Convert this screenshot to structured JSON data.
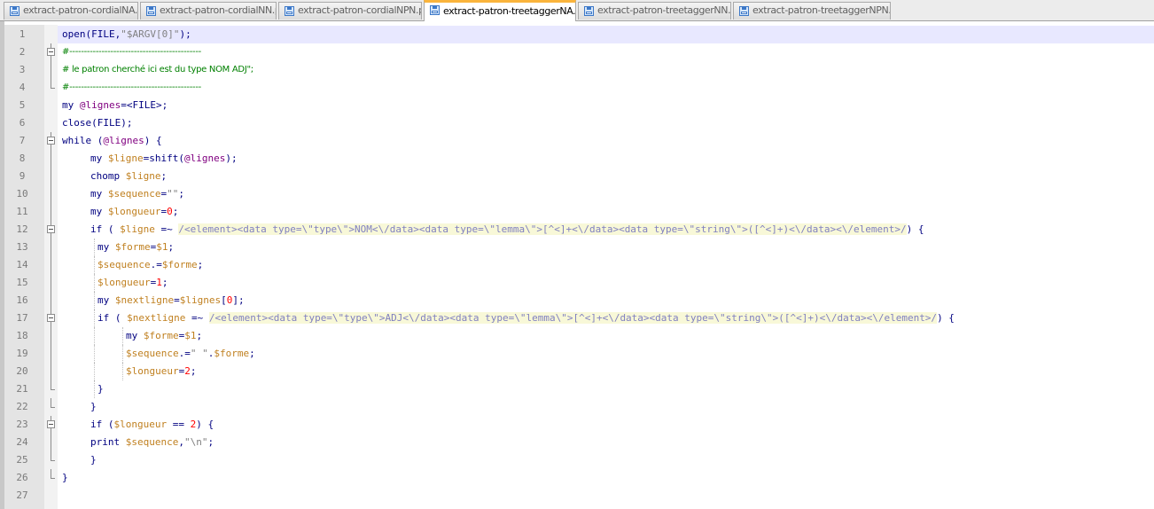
{
  "tabs": [
    {
      "label": "extract-patron-cordialNA.pl",
      "active": false
    },
    {
      "label": "extract-patron-cordialNN.pl",
      "active": false
    },
    {
      "label": "extract-patron-cordialNPN.pl",
      "active": false
    },
    {
      "label": "extract-patron-treetaggerNA.pl",
      "active": true
    },
    {
      "label": "extract-patron-treetaggerNN.pl",
      "active": false
    },
    {
      "label": "extract-patron-treetaggerNPN.pl",
      "active": false
    }
  ],
  "icons": {
    "tab": "floppy-disk-icon",
    "fold": "fold-minus-icon"
  },
  "colors": {
    "keyword": "#000080",
    "array": "#800080",
    "scalar": "#c08020",
    "string": "#808080",
    "number": "#ff0000",
    "comment": "#008000",
    "regex": "#8080c0",
    "active_tab_accent": "#fab43c"
  },
  "editor": {
    "lines": [
      {
        "n": "1",
        "tokens": [
          {
            "t": "open(FILE,",
            "c": "kw"
          },
          {
            "t": "\"$ARGV[0]\"",
            "c": "str"
          },
          {
            "t": ");",
            "c": "kw"
          }
        ]
      },
      {
        "n": "2",
        "cmt": true,
        "tokens": [
          {
            "t": "#---------------------------------------------",
            "c": "cmt"
          }
        ]
      },
      {
        "n": "3",
        "cmt": true,
        "tokens": [
          {
            "t": "# le patron cherché ici est du type NOM ADJ\";",
            "c": "cmt"
          }
        ]
      },
      {
        "n": "4",
        "cmt": true,
        "tokens": [
          {
            "t": "#---------------------------------------------",
            "c": "cmt"
          }
        ]
      },
      {
        "n": "5",
        "tokens": [
          {
            "t": "my ",
            "c": "kw"
          },
          {
            "t": "@lignes",
            "c": "arr"
          },
          {
            "t": "=<FILE>;",
            "c": "kw"
          }
        ]
      },
      {
        "n": "6",
        "tokens": [
          {
            "t": "close(FILE);",
            "c": "kw"
          }
        ]
      },
      {
        "n": "7",
        "tokens": [
          {
            "t": "while (",
            "c": "kw"
          },
          {
            "t": "@lignes",
            "c": "arr"
          },
          {
            "t": ") {",
            "c": "kw"
          }
        ]
      },
      {
        "n": "8",
        "tokens": [
          {
            "t": "my ",
            "c": "kw"
          },
          {
            "t": "$ligne",
            "c": "var"
          },
          {
            "t": "=shift(",
            "c": "kw"
          },
          {
            "t": "@lignes",
            "c": "arr"
          },
          {
            "t": ");",
            "c": "kw"
          }
        ]
      },
      {
        "n": "9",
        "tokens": [
          {
            "t": "chomp ",
            "c": "kw"
          },
          {
            "t": "$ligne",
            "c": "var"
          },
          {
            "t": ";",
            "c": "kw"
          }
        ]
      },
      {
        "n": "10",
        "tokens": [
          {
            "t": "my ",
            "c": "kw"
          },
          {
            "t": "$sequence",
            "c": "var"
          },
          {
            "t": "=",
            "c": "kw"
          },
          {
            "t": "\"\"",
            "c": "str"
          },
          {
            "t": ";",
            "c": "kw"
          }
        ]
      },
      {
        "n": "11",
        "tokens": [
          {
            "t": "my ",
            "c": "kw"
          },
          {
            "t": "$longueur",
            "c": "var"
          },
          {
            "t": "=",
            "c": "kw"
          },
          {
            "t": "0",
            "c": "num"
          },
          {
            "t": ";",
            "c": "kw"
          }
        ]
      },
      {
        "n": "12",
        "tokens": [
          {
            "t": "if ( ",
            "c": "kw"
          },
          {
            "t": "$ligne",
            "c": "var"
          },
          {
            "t": " =~ ",
            "c": "kw"
          },
          {
            "t": "/<element><data type=\\\"type\\\">NOM<\\/data><data type=\\\"lemma\\\">[^<]+<\\/data><data type=\\\"string\\\">([^<]+)<\\/data><\\/element>/",
            "c": "rx"
          },
          {
            "t": ") {",
            "c": "kw"
          }
        ]
      },
      {
        "n": "13",
        "tokens": [
          {
            "t": "my ",
            "c": "kw"
          },
          {
            "t": "$forme",
            "c": "var"
          },
          {
            "t": "=",
            "c": "kw"
          },
          {
            "t": "$1",
            "c": "var"
          },
          {
            "t": ";",
            "c": "kw"
          }
        ]
      },
      {
        "n": "14",
        "tokens": [
          {
            "t": "$sequence",
            "c": "var"
          },
          {
            "t": ".=",
            "c": "kw"
          },
          {
            "t": "$forme",
            "c": "var"
          },
          {
            "t": ";",
            "c": "kw"
          }
        ]
      },
      {
        "n": "15",
        "tokens": [
          {
            "t": "$longueur",
            "c": "var"
          },
          {
            "t": "=",
            "c": "kw"
          },
          {
            "t": "1",
            "c": "num"
          },
          {
            "t": ";",
            "c": "kw"
          }
        ]
      },
      {
        "n": "16",
        "tokens": [
          {
            "t": "my ",
            "c": "kw"
          },
          {
            "t": "$nextligne",
            "c": "var"
          },
          {
            "t": "=",
            "c": "kw"
          },
          {
            "t": "$lignes",
            "c": "var"
          },
          {
            "t": "[",
            "c": "kw"
          },
          {
            "t": "0",
            "c": "num"
          },
          {
            "t": "];",
            "c": "kw"
          }
        ]
      },
      {
        "n": "17",
        "tokens": [
          {
            "t": "if ( ",
            "c": "kw"
          },
          {
            "t": "$nextligne",
            "c": "var"
          },
          {
            "t": " =~ ",
            "c": "kw"
          },
          {
            "t": "/<element><data type=\\\"type\\\">ADJ<\\/data><data type=\\\"lemma\\\">[^<]+<\\/data><data type=\\\"string\\\">([^<]+)<\\/data><\\/element>/",
            "c": "rx"
          },
          {
            "t": ") {",
            "c": "kw"
          }
        ]
      },
      {
        "n": "18",
        "tokens": [
          {
            "t": "my ",
            "c": "kw"
          },
          {
            "t": "$forme",
            "c": "var"
          },
          {
            "t": "=",
            "c": "kw"
          },
          {
            "t": "$1",
            "c": "var"
          },
          {
            "t": ";",
            "c": "kw"
          }
        ]
      },
      {
        "n": "19",
        "tokens": [
          {
            "t": "$sequence",
            "c": "var"
          },
          {
            "t": ".=",
            "c": "kw"
          },
          {
            "t": "\" \"",
            "c": "str"
          },
          {
            "t": ".",
            "c": "kw"
          },
          {
            "t": "$forme",
            "c": "var"
          },
          {
            "t": ";",
            "c": "kw"
          }
        ]
      },
      {
        "n": "20",
        "tokens": [
          {
            "t": "$longueur",
            "c": "var"
          },
          {
            "t": "=",
            "c": "kw"
          },
          {
            "t": "2",
            "c": "num"
          },
          {
            "t": ";",
            "c": "kw"
          }
        ]
      },
      {
        "n": "21",
        "tokens": [
          {
            "t": "}",
            "c": "kw"
          }
        ]
      },
      {
        "n": "22",
        "tokens": [
          {
            "t": "}",
            "c": "kw"
          }
        ]
      },
      {
        "n": "23",
        "tokens": [
          {
            "t": "if (",
            "c": "kw"
          },
          {
            "t": "$longueur",
            "c": "var"
          },
          {
            "t": " == ",
            "c": "kw"
          },
          {
            "t": "2",
            "c": "num"
          },
          {
            "t": ") {",
            "c": "kw"
          }
        ]
      },
      {
        "n": "24",
        "tokens": [
          {
            "t": "print ",
            "c": "kw"
          },
          {
            "t": "$sequence",
            "c": "var"
          },
          {
            "t": ",",
            "c": "kw"
          },
          {
            "t": "\"\\n\"",
            "c": "str"
          },
          {
            "t": ";",
            "c": "kw"
          }
        ]
      },
      {
        "n": "25",
        "tokens": [
          {
            "t": "}",
            "c": "kw"
          }
        ]
      },
      {
        "n": "26",
        "tokens": [
          {
            "t": "}",
            "c": "kw"
          }
        ]
      },
      {
        "n": "27",
        "tokens": []
      }
    ]
  }
}
